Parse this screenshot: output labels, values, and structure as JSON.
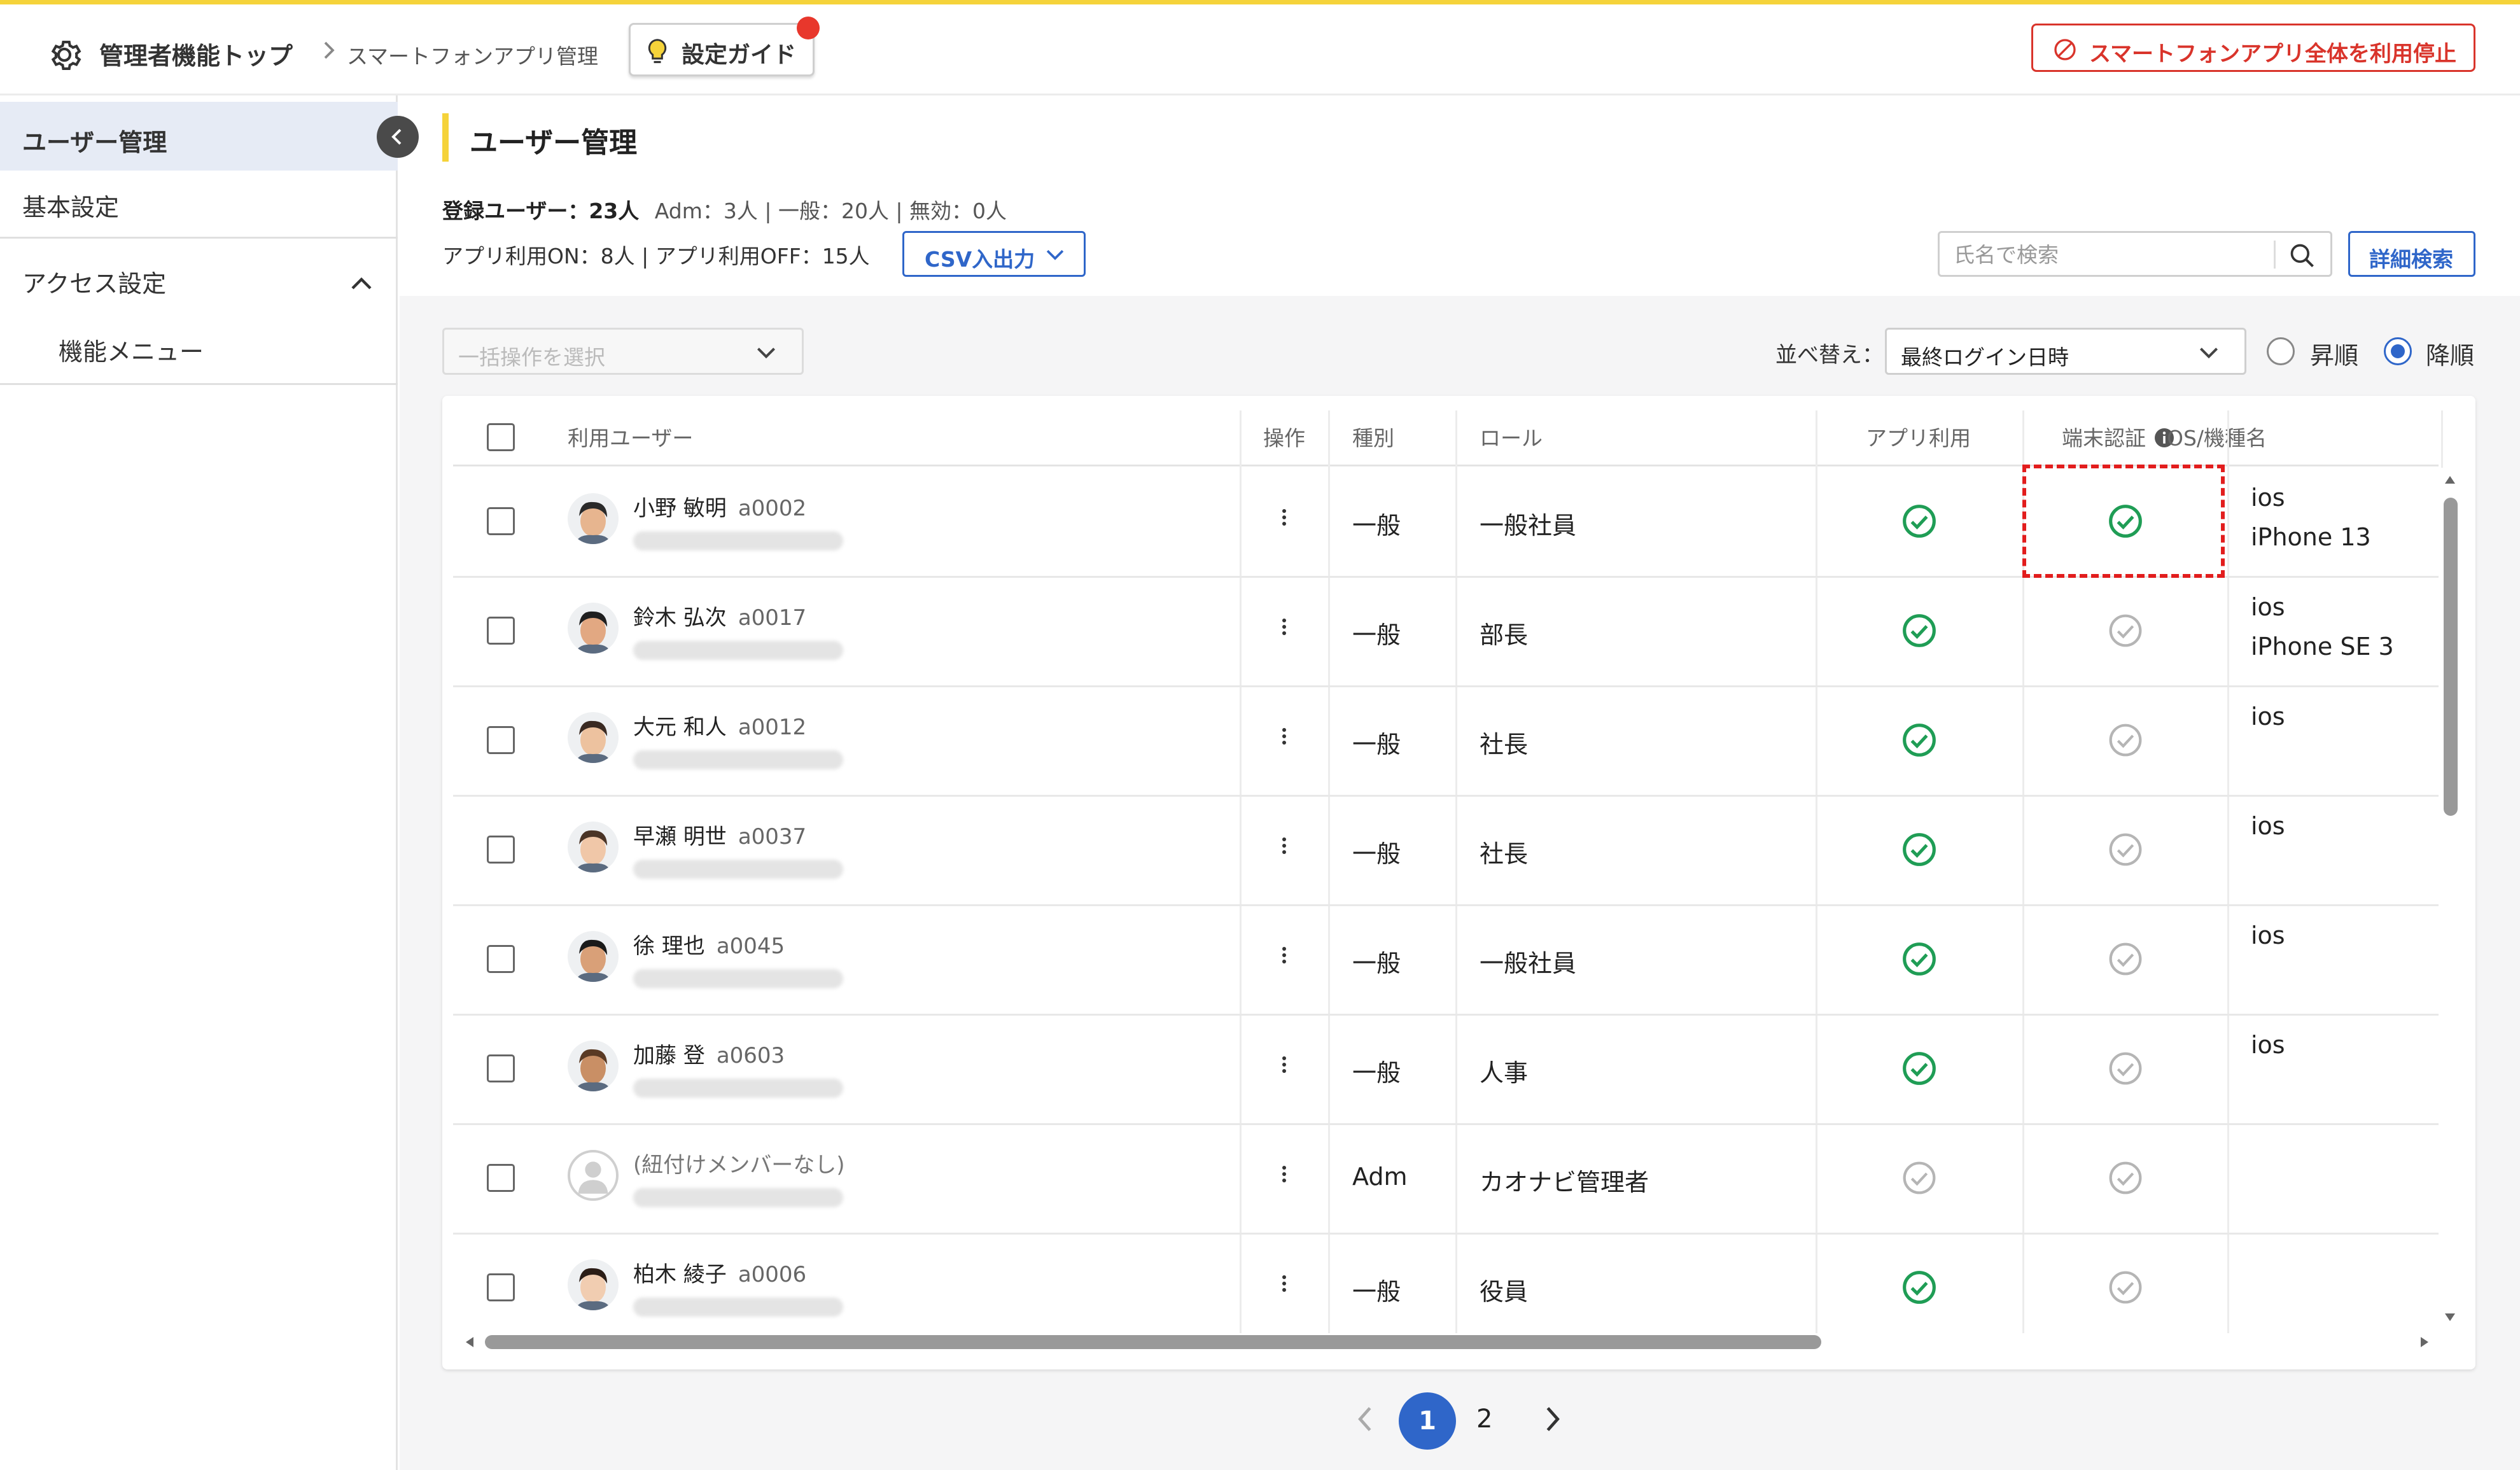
{
  "header": {
    "title": "管理者機能トップ",
    "breadcrumb": "スマートフォンアプリ管理",
    "guide_label": "設定ガイド",
    "stop_label": "スマートフォンアプリ全体を利用停止"
  },
  "sidebar": {
    "items": [
      {
        "label": "ユーザー管理",
        "active": true
      },
      {
        "label": "基本設定"
      },
      {
        "label": "アクセス設定",
        "expanded": true
      },
      {
        "label": "機能メニュー"
      }
    ]
  },
  "main": {
    "title": "ユーザー管理",
    "summary_registered_label": "登録ユーザー：23人",
    "summary_breakdown": "Adm：3人 | 一般：20人 | 無効：0人",
    "summary_app": "アプリ利用ON：8人 | アプリ利用OFF：15人",
    "csv_label": "CSV入出力",
    "search_placeholder": "氏名で検索",
    "advanced_search_label": "詳細検索",
    "bulk_placeholder": "一括操作を選択",
    "sort_label": "並べ替え：",
    "sort_value": "最終ログイン日時",
    "order_asc": "昇順",
    "order_desc": "降順",
    "order_selected": "降順"
  },
  "table": {
    "columns": [
      "利用ユーザー",
      "操作",
      "種別",
      "ロール",
      "アプリ利用",
      "端末認証",
      "OS/機種名"
    ],
    "rows": [
      {
        "name": "小野 敏明",
        "code": "a0002",
        "type": "一般",
        "role": "一般社員",
        "app": true,
        "device_auth": true,
        "os": "ios",
        "model": "iPhone 13"
      },
      {
        "name": "鈴木 弘次",
        "code": "a0017",
        "type": "一般",
        "role": "部長",
        "app": true,
        "device_auth": false,
        "os": "ios",
        "model": "iPhone SE 3"
      },
      {
        "name": "大元 和人",
        "code": "a0012",
        "type": "一般",
        "role": "社長",
        "app": true,
        "device_auth": false,
        "os": "ios",
        "model": ""
      },
      {
        "name": "早瀬 明世",
        "code": "a0037",
        "type": "一般",
        "role": "社長",
        "app": true,
        "device_auth": false,
        "os": "ios",
        "model": ""
      },
      {
        "name": "徐 理也",
        "code": "a0045",
        "type": "一般",
        "role": "一般社員",
        "app": true,
        "device_auth": false,
        "os": "ios",
        "model": ""
      },
      {
        "name": "加藤 登",
        "code": "a0603",
        "type": "一般",
        "role": "人事",
        "app": true,
        "device_auth": false,
        "os": "ios",
        "model": ""
      },
      {
        "name": "(紐付けメンバーなし)",
        "code": "",
        "type": "Adm",
        "role": "カオナビ管理者",
        "app": false,
        "device_auth": false,
        "os": "",
        "model": ""
      },
      {
        "name": "柏木 綾子",
        "code": "a0006",
        "type": "一般",
        "role": "役員",
        "app": true,
        "device_auth": false,
        "os": "",
        "model": ""
      }
    ]
  },
  "pagination": {
    "current": "1",
    "next_page": "2"
  },
  "colors": {
    "accent": "#2f66c9",
    "danger": "#d9342b",
    "brand_yellow": "#f5d33a",
    "check_on": "#1f9d55",
    "check_off": "#b5b5b5"
  },
  "icons": [
    "gear-icon",
    "lightbulb-icon",
    "prohibited-icon",
    "search-icon",
    "chevron-down-icon",
    "chevron-up-icon",
    "chevron-left-icon",
    "kebab-menu-icon",
    "check-circle-icon",
    "info-icon"
  ]
}
